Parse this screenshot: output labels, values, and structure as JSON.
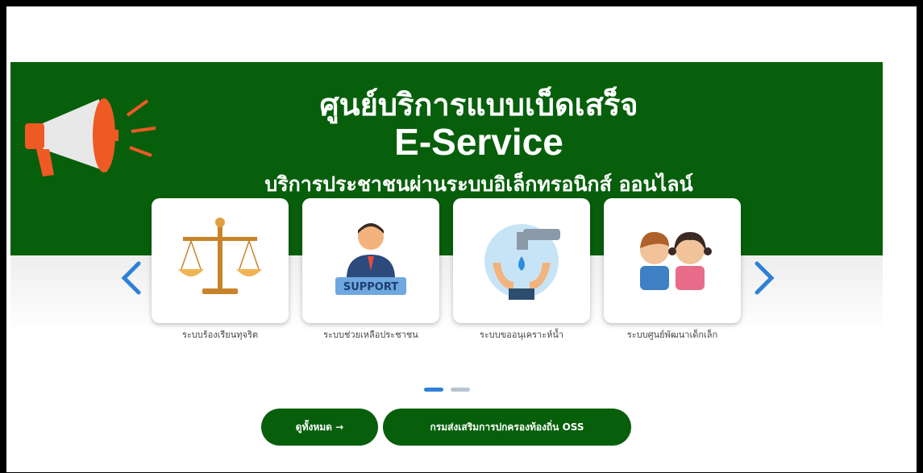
{
  "banner": {
    "title_line1": "ศูนย์บริการแบบเบ็ดเสร็จ",
    "title_line2": "E-Service",
    "subtitle": "บริการประชาชนผ่านระบบอิเล็กทรอนิกส์ ออนไลน์",
    "color": "#075f0b"
  },
  "cards": [
    {
      "label": "ระบบร้องเรียนทุจริต",
      "icon": "scales-icon"
    },
    {
      "label": "ระบบช่วยเหลือประชาชน",
      "icon": "support-agent-icon"
    },
    {
      "label": "ระบบขออนุเคราะห์น้ำ",
      "icon": "water-tap-icon"
    },
    {
      "label": "ระบบศูนย์พัฒนาเด็กเล็ก",
      "icon": "children-icon"
    }
  ],
  "support_badge_text": "SUPPORT",
  "buttons": {
    "view_all": "ดูทั้งหมด →",
    "oss": "กรมส่งเสริมการปกครองท้องถิ่น OSS"
  },
  "carousel": {
    "active_page": 1,
    "page_count": 2
  }
}
